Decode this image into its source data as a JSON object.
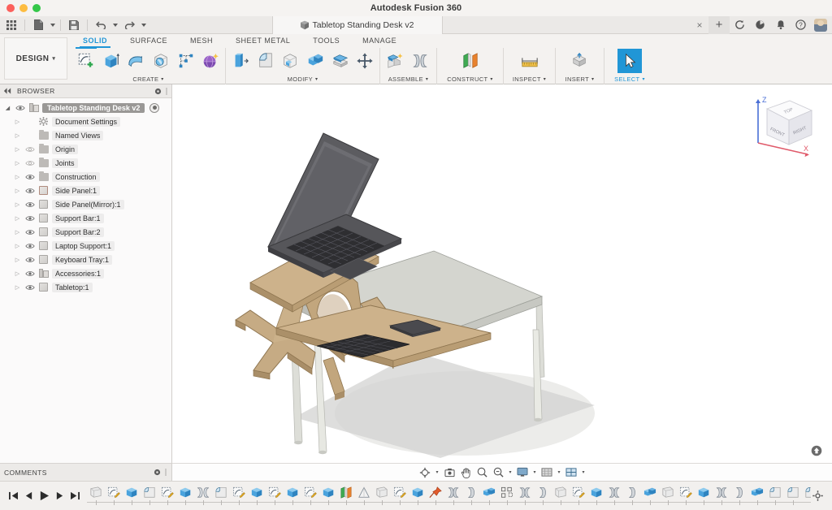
{
  "window": {
    "app_title": "Autodesk Fusion 360",
    "traffic_lights": [
      "close",
      "minimize",
      "zoom"
    ]
  },
  "quick_access": {
    "grid_icon": "app-grid-icon",
    "new_icon": "new-document-icon",
    "save_icon": "save-icon",
    "undo_icon": "undo-icon",
    "redo_icon": "redo-icon"
  },
  "document_tab": {
    "label": "Tabletop Standing Desk v2",
    "icon": "cube-icon",
    "close_label": "×",
    "add_tab_label": "+"
  },
  "header_icons": [
    {
      "name": "job-status-icon",
      "glyph": "refresh"
    },
    {
      "name": "data-panel-icon",
      "glyph": "clock"
    },
    {
      "name": "notifications-icon",
      "glyph": "bell"
    },
    {
      "name": "help-icon",
      "glyph": "question"
    },
    {
      "name": "account-avatar",
      "glyph": "avatar"
    }
  ],
  "workspace": {
    "selector_label": "DESIGN",
    "selector_caret": "▾"
  },
  "ribbon": {
    "tabs": [
      {
        "label": "SOLID",
        "active": true
      },
      {
        "label": "SURFACE",
        "active": false
      },
      {
        "label": "MESH",
        "active": false
      },
      {
        "label": "SHEET METAL",
        "active": false
      },
      {
        "label": "TOOLS",
        "active": false
      },
      {
        "label": "MANAGE",
        "active": false
      }
    ],
    "groups": [
      {
        "label": "CREATE",
        "caret": "▾",
        "items": [
          {
            "name": "create-sketch-button",
            "icon": "sketch-icon",
            "selected_underline": true
          },
          {
            "name": "extrude-button",
            "icon": "extrude-icon"
          },
          {
            "name": "revolve-button",
            "icon": "revolve-icon"
          },
          {
            "name": "sweep-button",
            "icon": "sphere-in-box-icon"
          },
          {
            "name": "pattern-button",
            "icon": "rectangular-pattern-icon"
          },
          {
            "name": "create-form-button",
            "icon": "form-sphere-icon"
          }
        ]
      },
      {
        "label": "MODIFY",
        "caret": "▾",
        "items": [
          {
            "name": "press-pull-button",
            "icon": "press-pull-icon"
          },
          {
            "name": "fillet-button",
            "icon": "fillet-icon"
          },
          {
            "name": "shell-button",
            "icon": "shell-icon"
          },
          {
            "name": "combine-button",
            "icon": "combine-icon"
          },
          {
            "name": "split-face-button",
            "icon": "split-icon"
          },
          {
            "name": "move-copy-button",
            "icon": "move-arrows-icon"
          }
        ]
      },
      {
        "label": "ASSEMBLE",
        "caret": "▾",
        "items": [
          {
            "name": "new-component-button",
            "icon": "new-component-icon"
          },
          {
            "name": "joint-button",
            "icon": "joint-icon"
          }
        ]
      },
      {
        "label": "CONSTRUCT",
        "caret": "▾",
        "items": [
          {
            "name": "offset-plane-button",
            "icon": "offset-plane-icon"
          }
        ]
      },
      {
        "label": "INSPECT",
        "caret": "▾",
        "items": [
          {
            "name": "measure-button",
            "icon": "measure-icon"
          }
        ]
      },
      {
        "label": "INSERT",
        "caret": "▾",
        "items": [
          {
            "name": "insert-mcmaster-button",
            "icon": "insert-icon"
          }
        ]
      },
      {
        "label": "SELECT",
        "caret": "▾",
        "selected": true,
        "items": [
          {
            "name": "select-tool-button",
            "icon": "cursor-arrow-icon",
            "selected": true
          }
        ]
      }
    ]
  },
  "browser": {
    "title": "BROWSER",
    "collapse_icon": "collapse-left-icon",
    "settings_icon": "panel-settings-icon",
    "items": [
      {
        "label": "Tabletop Standing Desk v2",
        "icon": "component-icon",
        "level": 0,
        "root": true,
        "arrow": "◢",
        "eye": true
      },
      {
        "label": "Document Settings",
        "icon": "gear-icon",
        "level": 1,
        "arrow": "▷",
        "eye": false
      },
      {
        "label": "Named Views",
        "icon": "folder-icon",
        "level": 1,
        "arrow": "▷",
        "eye": false
      },
      {
        "label": "Origin",
        "icon": "folder-icon",
        "level": 1,
        "arrow": "▷",
        "eye": true,
        "eye_off": true
      },
      {
        "label": "Joints",
        "icon": "folder-icon",
        "level": 1,
        "arrow": "▷",
        "eye": true,
        "eye_off": true
      },
      {
        "label": "Construction",
        "icon": "folder-icon",
        "level": 1,
        "arrow": "▷",
        "eye": true
      },
      {
        "label": "Side Panel:1",
        "icon": "body-icon-red",
        "level": 1,
        "arrow": "▷",
        "eye": true
      },
      {
        "label": "Side Panel(Mirror):1",
        "icon": "body-icon",
        "level": 1,
        "arrow": "▷",
        "eye": true
      },
      {
        "label": "Support Bar:1",
        "icon": "body-icon",
        "level": 1,
        "arrow": "▷",
        "eye": true
      },
      {
        "label": "Support Bar:2",
        "icon": "body-icon",
        "level": 1,
        "arrow": "▷",
        "eye": true
      },
      {
        "label": "Laptop Support:1",
        "icon": "body-icon",
        "level": 1,
        "arrow": "▷",
        "eye": true
      },
      {
        "label": "Keyboard Tray:1",
        "icon": "body-icon",
        "level": 1,
        "arrow": "▷",
        "eye": true
      },
      {
        "label": "Accessories:1",
        "icon": "component-icon",
        "level": 1,
        "arrow": "▷",
        "eye": true
      },
      {
        "label": "Tabletop:1",
        "icon": "body-icon",
        "level": 1,
        "arrow": "▷",
        "eye": true
      }
    ]
  },
  "viewcube": {
    "top_label": "TOP",
    "front_label": "FRONT",
    "right_label": "RIGHT",
    "axis_z": "Z",
    "axis_x": "X"
  },
  "canvas": {
    "model_description": "Tabletop standing desk with laptop, keyboard and trackpad on a table",
    "background": "#ffffff",
    "plywood_color": "#c9b08a",
    "tabletop_color": "#cfd0c9",
    "laptop_color": "#4a4a4f",
    "shadow_color": "#c8c8c6"
  },
  "comments": {
    "title": "COMMENTS",
    "settings_icon": "panel-settings-icon"
  },
  "nav_bar": {
    "items": [
      {
        "name": "orbit-button",
        "icon": "orbit-icon",
        "caret": "▾"
      },
      {
        "name": "look-at-button",
        "icon": "look-at-icon"
      },
      {
        "name": "pan-button",
        "icon": "pan-hand-icon"
      },
      {
        "name": "zoom-button",
        "icon": "zoom-icon"
      },
      {
        "name": "zoom-window-button",
        "icon": "zoom-window-icon",
        "caret": "▾"
      },
      {
        "name": "display-settings-button",
        "icon": "display-settings-icon",
        "caret": "▾"
      },
      {
        "name": "grid-snaps-button",
        "icon": "grid-snaps-icon",
        "caret": "▾"
      },
      {
        "name": "viewports-button",
        "icon": "viewports-icon",
        "caret": "▾"
      }
    ]
  },
  "timeline": {
    "playback": [
      {
        "name": "timeline-begin-button",
        "glyph": "⏮"
      },
      {
        "name": "timeline-step-back-button",
        "glyph": "◀"
      },
      {
        "name": "timeline-play-button",
        "glyph": "▶"
      },
      {
        "name": "timeline-step-forward-button",
        "glyph": "▶"
      },
      {
        "name": "timeline-end-button",
        "glyph": "⏭"
      }
    ],
    "features": [
      "sketch-gray",
      "sketch-edit",
      "extrude",
      "fillet",
      "sketch-edit",
      "extrude",
      "joint",
      "fillet",
      "sketch-edit",
      "extrude",
      "sketch-edit",
      "extrude",
      "sketch-edit",
      "extrude",
      "mirror",
      "cone",
      "sketch-gray",
      "sketch-edit",
      "extrude",
      "pin-joint",
      "joint-a",
      "joint-b",
      "combine",
      "pattern",
      "joint-a",
      "joint-b",
      "sketch-gray",
      "sketch-edit",
      "extrude",
      "joint-a",
      "joint-b",
      "combine",
      "sketch-gray",
      "sketch-edit",
      "extrude",
      "joint-a",
      "joint-b",
      "combine",
      "fillet",
      "fillet",
      "fillet",
      "shell"
    ],
    "settings_icon": "timeline-settings-icon"
  }
}
